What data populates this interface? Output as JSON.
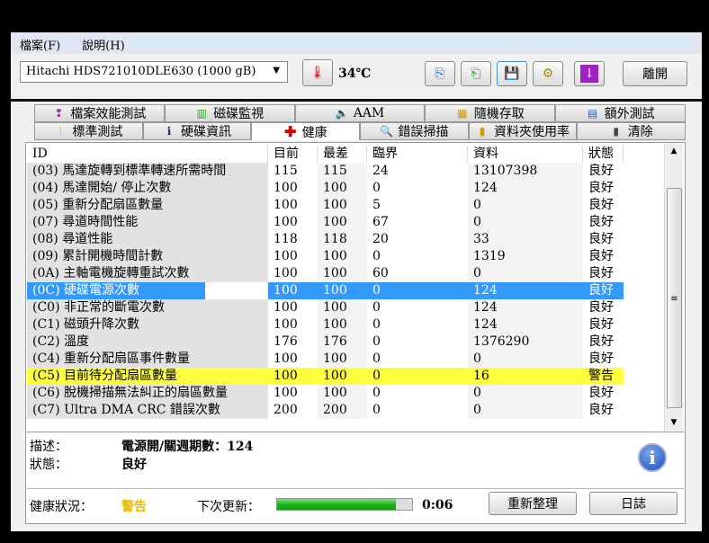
{
  "menu": [
    "檔案(F)",
    "說明(H)"
  ],
  "drive": "Hitachi HDS721010DLE630 (1000 gB)",
  "temperature": "34℃",
  "exit_label": "離開",
  "tabs_top": [
    {
      "label": "檔案效能測試",
      "icon": "file-benchmark-icon"
    },
    {
      "label": "磁碟監視",
      "icon": "disk-monitor-icon"
    },
    {
      "label": "AAM",
      "icon": "speaker-icon"
    },
    {
      "label": "隨機存取",
      "icon": "random-access-icon"
    },
    {
      "label": "額外測試",
      "icon": "extra-tests-icon"
    }
  ],
  "tabs_bottom": [
    {
      "label": "標準測試",
      "icon": "exclamation-icon"
    },
    {
      "label": "硬碟資訊",
      "icon": "info-icon"
    },
    {
      "label": "健康",
      "icon": "health-cross-icon",
      "active": true
    },
    {
      "label": "錯誤掃描",
      "icon": "magnifier-icon"
    },
    {
      "label": "資料夾使用率",
      "icon": "folder-icon"
    },
    {
      "label": "清除",
      "icon": "trash-icon"
    }
  ],
  "table": {
    "headers": [
      "ID",
      "目前",
      "最差",
      "臨界",
      "資料",
      "狀態"
    ],
    "rows": [
      [
        "(03) 馬達旋轉到標準轉速所需時間",
        "115",
        "115",
        "24",
        "13107398",
        "良好"
      ],
      [
        "(04) 馬達開始/ 停止次數",
        "100",
        "100",
        "0",
        "124",
        "良好"
      ],
      [
        "(05) 重新分配扇區數量",
        "100",
        "100",
        "5",
        "0",
        "良好"
      ],
      [
        "(07) 尋道時間性能",
        "100",
        "100",
        "67",
        "0",
        "良好"
      ],
      [
        "(08) 尋道性能",
        "118",
        "118",
        "20",
        "33",
        "良好"
      ],
      [
        "(09) 累計開機時間計數",
        "100",
        "100",
        "0",
        "1319",
        "良好"
      ],
      [
        "(0A) 主軸電機旋轉重試次數",
        "100",
        "100",
        "60",
        "0",
        "良好"
      ],
      [
        "(0C) 硬碟電源次數",
        "100",
        "100",
        "0",
        "124",
        "良好"
      ],
      [
        "(C0) 非正常的斷電次數",
        "100",
        "100",
        "0",
        "124",
        "良好"
      ],
      [
        "(C1) 磁頭升降次數",
        "100",
        "100",
        "0",
        "124",
        "良好"
      ],
      [
        "(C2) 溫度",
        "176",
        "176",
        "0",
        "1376290",
        "良好"
      ],
      [
        "(C4) 重新分配扇區事件數量",
        "100",
        "100",
        "0",
        "0",
        "良好"
      ],
      [
        "(C5) 目前待分配扇區數量",
        "100",
        "100",
        "0",
        "16",
        "警告"
      ],
      [
        "(C6) 脫機掃描無法糾正的扇區數量",
        "100",
        "100",
        "0",
        "0",
        "良好"
      ],
      [
        "(C7) Ultra DMA CRC 錯誤次數",
        "200",
        "200",
        "0",
        "0",
        "良好"
      ]
    ],
    "selected_row": 7,
    "warning_row": 12
  },
  "details": {
    "desc_label": "描述：",
    "desc_value": "電源開/關週期數：124",
    "status_label": "狀態：",
    "status_value": "良好"
  },
  "footer": {
    "health_label": "健康狀況：",
    "health_value": "警告",
    "next_update_label": "下次更新：",
    "progress": 0.88,
    "countdown": "0:06",
    "refresh_label": "重新整理",
    "log_label": "日誌"
  },
  "colors": {
    "selected": "#3399ff",
    "warning": "#ffff40",
    "health_warning": "#e6b800"
  }
}
